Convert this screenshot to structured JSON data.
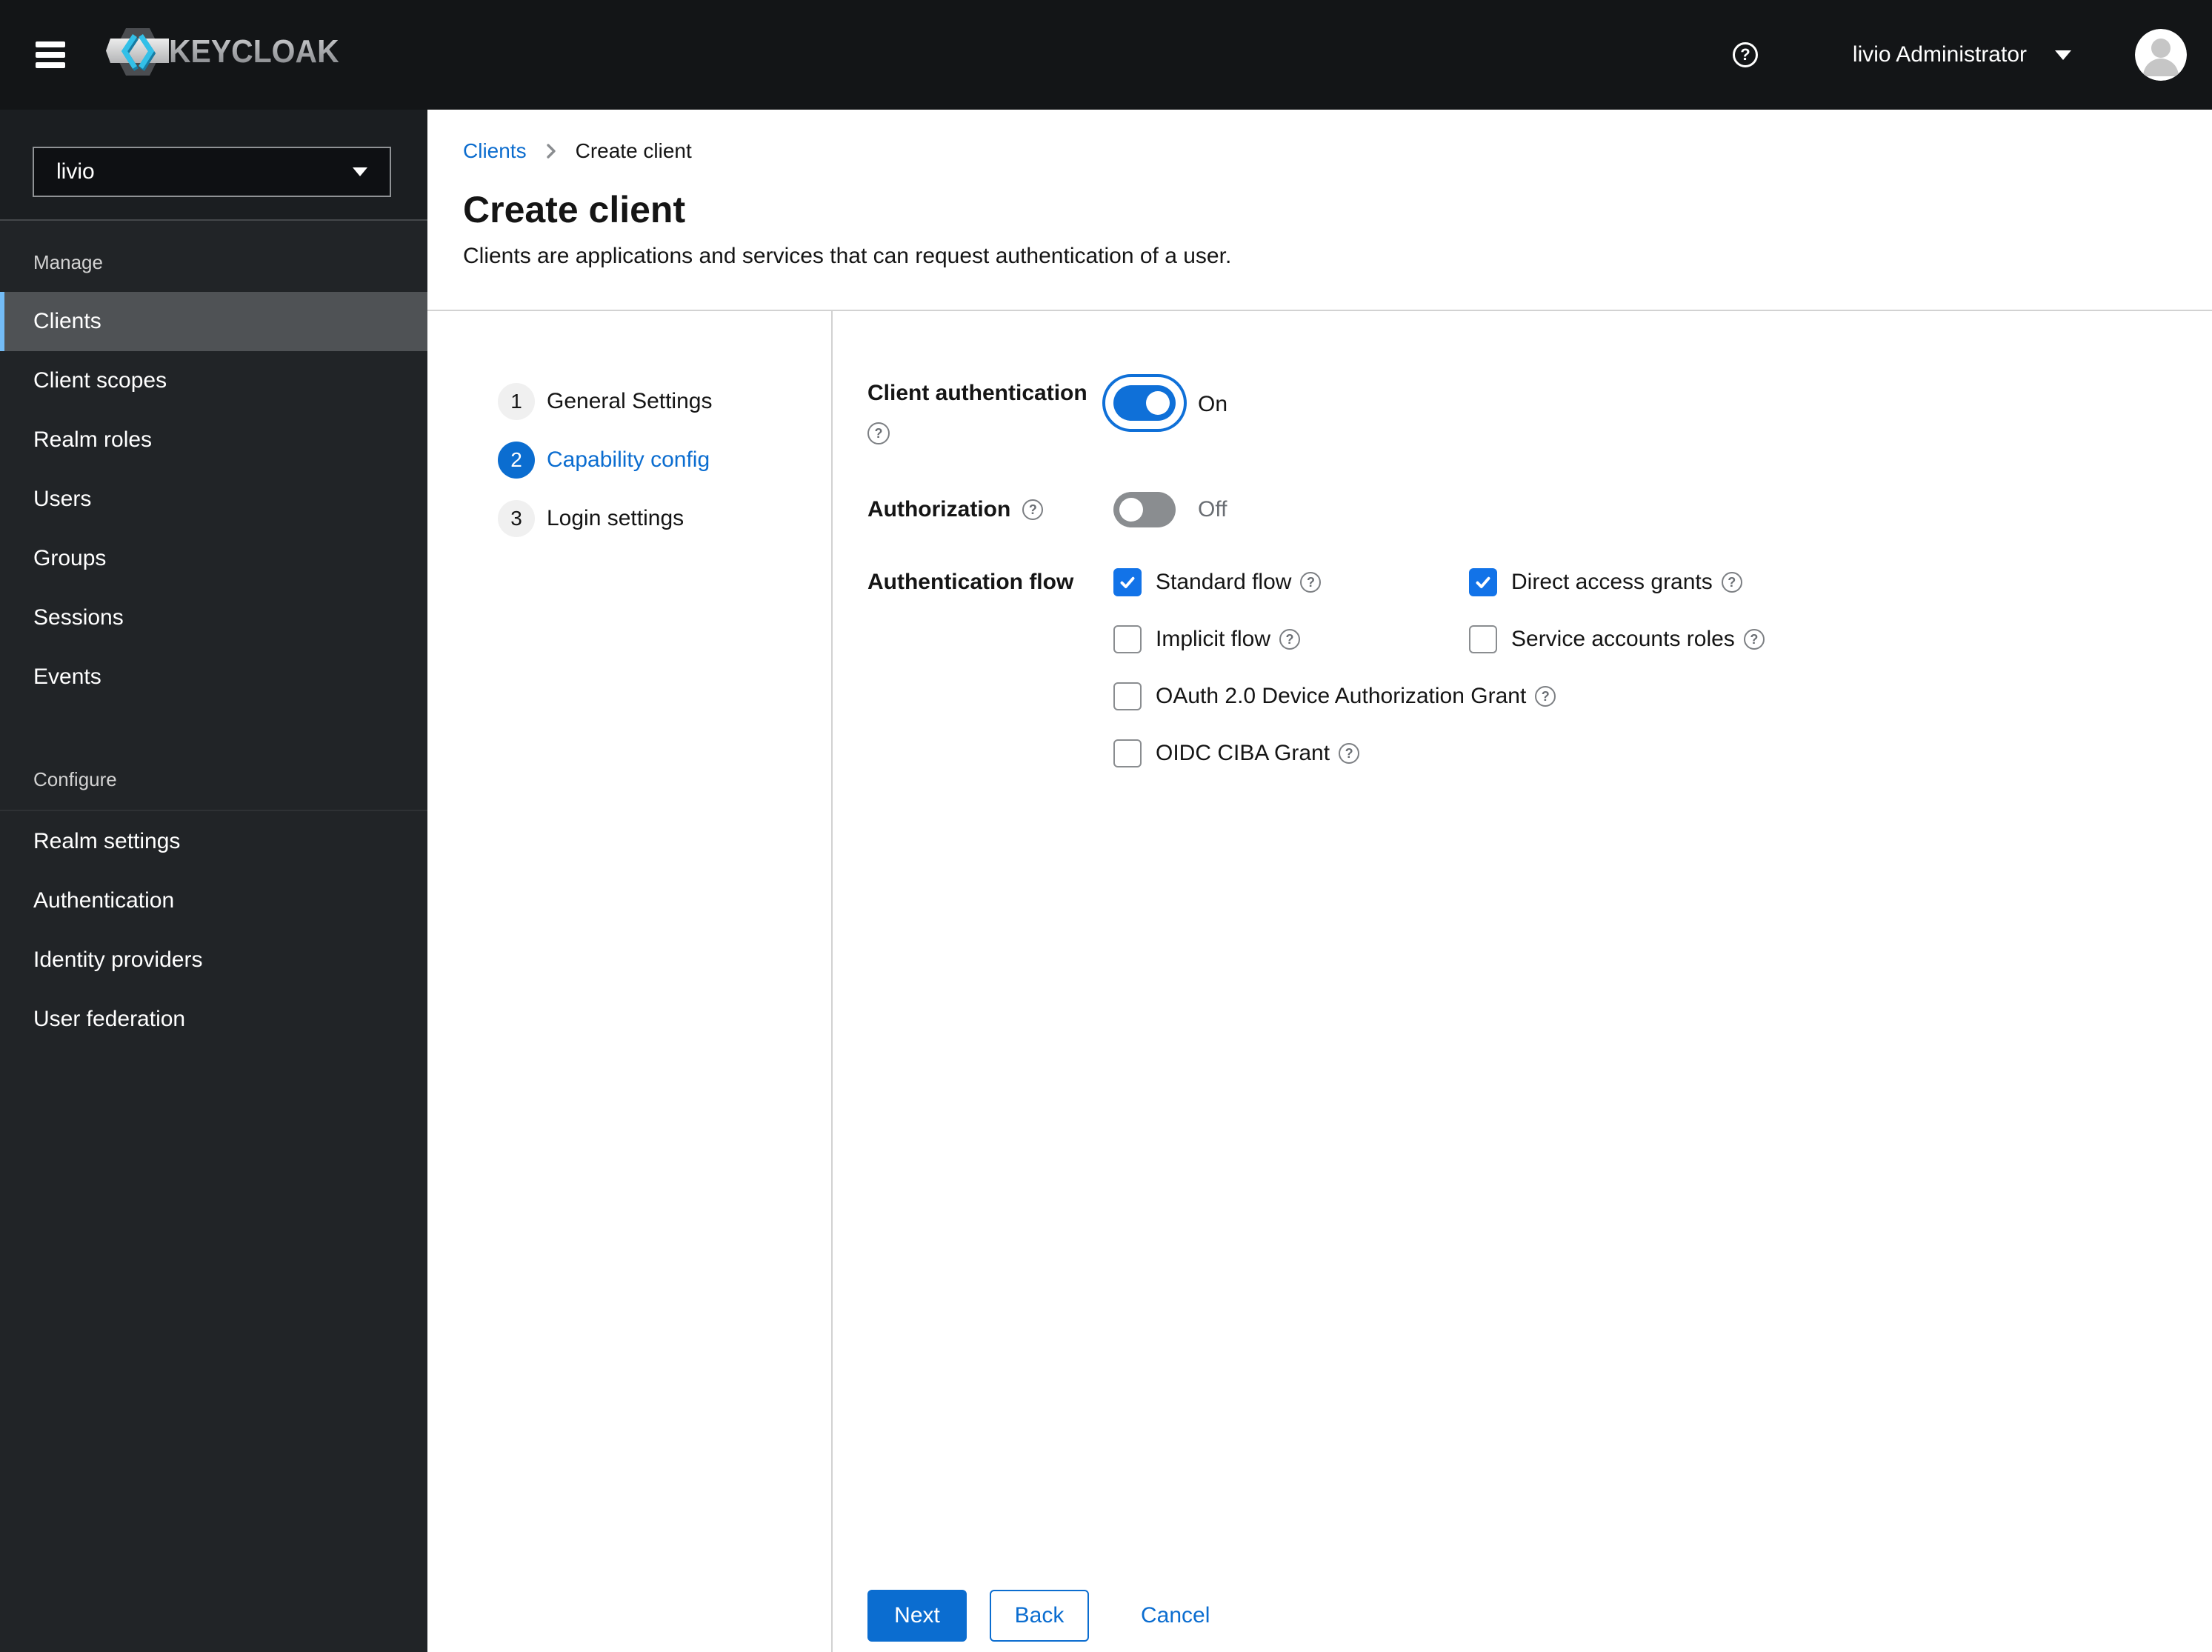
{
  "header": {
    "brand": "KEYCLOAK",
    "help_icon": "?",
    "user": "livio Administrator"
  },
  "sidebar": {
    "realm": "livio",
    "sections": [
      {
        "label": "Manage",
        "items": [
          {
            "label": "Clients",
            "selected": true
          },
          {
            "label": "Client scopes",
            "selected": false
          },
          {
            "label": "Realm roles",
            "selected": false
          },
          {
            "label": "Users",
            "selected": false
          },
          {
            "label": "Groups",
            "selected": false
          },
          {
            "label": "Sessions",
            "selected": false
          },
          {
            "label": "Events",
            "selected": false
          }
        ]
      },
      {
        "label": "Configure",
        "items": [
          {
            "label": "Realm settings",
            "selected": false
          },
          {
            "label": "Authentication",
            "selected": false
          },
          {
            "label": "Identity providers",
            "selected": false
          },
          {
            "label": "User federation",
            "selected": false
          }
        ]
      }
    ]
  },
  "breadcrumb": {
    "link": "Clients",
    "current": "Create client"
  },
  "page": {
    "title": "Create client",
    "subtitle": "Clients are applications and services that can request authentication of a user."
  },
  "wizard": {
    "steps": [
      {
        "num": "1",
        "label": "General Settings",
        "current": false
      },
      {
        "num": "2",
        "label": "Capability config",
        "current": true
      },
      {
        "num": "3",
        "label": "Login settings",
        "current": false
      }
    ],
    "form": {
      "client_authentication": {
        "label": "Client authentication",
        "value": "On",
        "enabled": true
      },
      "authorization": {
        "label": "Authorization",
        "value": "Off",
        "enabled": false
      },
      "authentication_flow": {
        "label": "Authentication flow",
        "options": [
          {
            "label": "Standard flow",
            "checked": true
          },
          {
            "label": "Direct access grants",
            "checked": true
          },
          {
            "label": "Implicit flow",
            "checked": false
          },
          {
            "label": "Service accounts roles",
            "checked": false
          },
          {
            "label": "OAuth 2.0 Device Authorization Grant",
            "checked": false
          },
          {
            "label": "OIDC CIBA Grant",
            "checked": false
          }
        ]
      }
    },
    "footer": {
      "next": "Next",
      "back": "Back",
      "cancel": "Cancel"
    }
  },
  "colors": {
    "primary_blue": "#0b6dd0",
    "control_blue": "#1273e8",
    "header_bg": "#131517",
    "sidebar_bg": "#212427",
    "selected_item_bg": "#4f5255",
    "selected_item_border": "#73bcf7"
  }
}
